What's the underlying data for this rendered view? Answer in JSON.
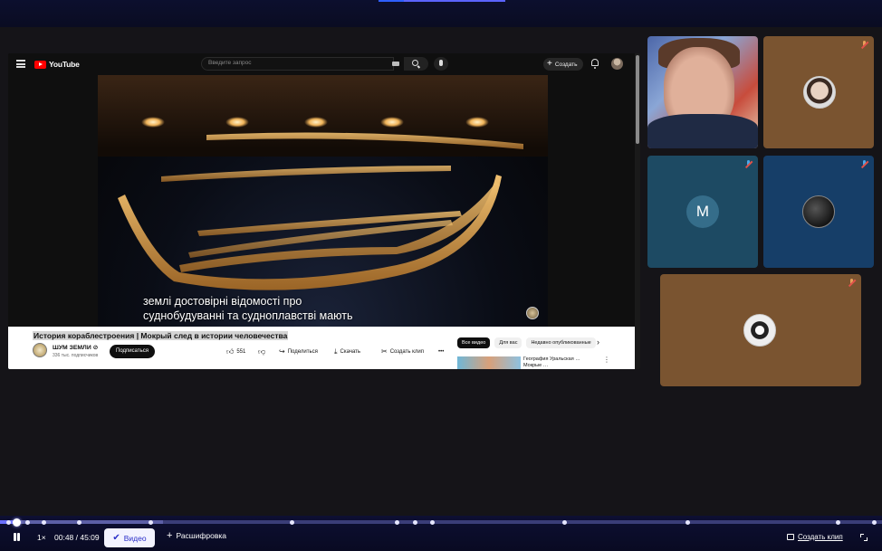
{
  "youtube": {
    "logo_text": "YouTube",
    "search_placeholder": "Введите запрос",
    "create_label": "Создать",
    "subtitle_line1": "землі достовірні відомості про",
    "subtitle_line2": "суднобудуванні та судноплавстві мають",
    "video_title": "История кораблестроения | Мокрый след в истории человечества",
    "channel_name": "ШУМ ЗЕМЛИ ⊘",
    "channel_subs": "336 тыс. подписчиков",
    "subscribe_label": "Подписаться",
    "likes": "551",
    "share_label": "Поделиться",
    "download_label": "Скачать",
    "clip_label": "Создать клип",
    "more_label": "•••",
    "chips": [
      "Все видео",
      "Для вас",
      "Недавно опубликованные"
    ],
    "rec_title": "География Уральская … Мокрые …"
  },
  "participants": {
    "letter_avatar": "M"
  },
  "player": {
    "speed": "1×",
    "time": "00:48 / 45:09",
    "video_label": "Видео",
    "transcript_label": "Расшифровка",
    "create_clip_label": "Создать клип",
    "progress_fraction": 0.018
  },
  "colors": {
    "accent": "#2b2fc8",
    "bar_bg": "#0d0f33",
    "youtube_red": "#ff0000",
    "tile_brown": "#7a5430",
    "tile_teal": "#1d4a63",
    "tile_blue": "#163e68"
  },
  "icons": [
    "hamburger-icon",
    "youtube-logo-icon",
    "keyboard-icon",
    "search-icon",
    "mic-icon",
    "plus-icon",
    "bell-icon",
    "like-icon",
    "dislike-icon",
    "share-icon",
    "download-icon",
    "scissors-icon",
    "chevron-right-icon",
    "mic-muted-icon",
    "pause-icon",
    "check-icon",
    "clip-icon",
    "fullscreen-icon"
  ]
}
